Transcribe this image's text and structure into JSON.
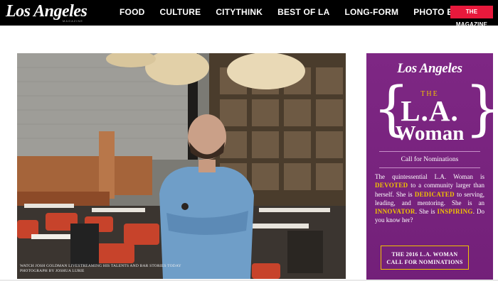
{
  "header": {
    "logo": "Los Angeles",
    "logo_sub": "MAGAZINE",
    "nav": [
      "FOOD",
      "CULTURE",
      "CITYTHINK",
      "BEST OF LA",
      "LONG-FORM",
      "PHOTO ESSAYS"
    ],
    "magazine_button": "THE MAGAZINE"
  },
  "hero": {
    "caption_line1": "WATCH JOSH GOLDMAN LIVESTREAMING HIS TALENTS AND BAR STORIES TODAY",
    "caption_line2": "PHOTOGRAPH BY JOSHUA LURIE"
  },
  "ad": {
    "logo": "Los Angeles",
    "brace_left": "{",
    "brace_right": "}",
    "the": "THE",
    "la": "L.A.",
    "woman": "Woman",
    "call": "Call for Nominations",
    "body": {
      "p1": "The quintessential L.A. Woman is",
      "h1": "DEVOTED",
      "p2": "to a community larger than herself. She is",
      "h2": "DEDICATED",
      "p3": "to serving, leading, and mentoring. She is an",
      "h3": "INNOVATOR",
      "p4": ". She is",
      "h4": "INSPIRING",
      "p5": ". Do you know her?"
    },
    "button_line1": "THE 2016 L.A. WOMAN",
    "button_line2": "CALL FOR NOMINATIONS"
  },
  "colors": {
    "nav_bg": "#000000",
    "accent_red": "#e8193c",
    "ad_purple": "#7a2583",
    "ad_highlight": "#f1c400"
  }
}
